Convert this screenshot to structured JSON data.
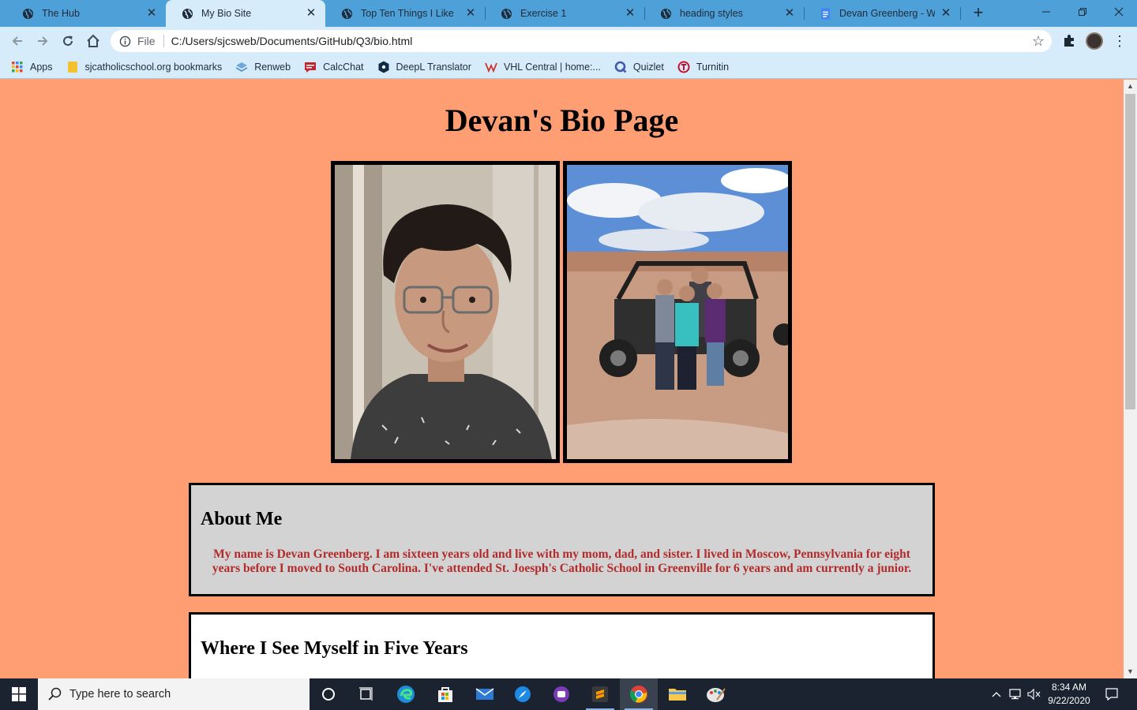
{
  "browser": {
    "tabs": [
      {
        "title": "The Hub",
        "icon": "globe-icon"
      },
      {
        "title": "My Bio Site",
        "icon": "globe-icon",
        "active": true
      },
      {
        "title": "Top Ten Things I Like",
        "icon": "globe-icon"
      },
      {
        "title": "Exercise 1",
        "icon": "globe-icon"
      },
      {
        "title": "heading styles",
        "icon": "globe-icon"
      },
      {
        "title": "Devan Greenberg - Web I",
        "icon": "docs-icon"
      }
    ],
    "address": {
      "scheme_label": "File",
      "url": "C:/Users/sjcsweb/Documents/GitHub/Q3/bio.html"
    },
    "bookmarks": [
      {
        "label": "Apps",
        "icon": "apps-grid-icon"
      },
      {
        "label": "sjcatholicschool.org bookmarks",
        "icon": "folder-icon"
      },
      {
        "label": "Renweb",
        "icon": "renweb-icon"
      },
      {
        "label": "CalcChat",
        "icon": "calcchat-icon"
      },
      {
        "label": "DeepL Translator",
        "icon": "deepl-icon"
      },
      {
        "label": "VHL Central | home:...",
        "icon": "vhl-icon"
      },
      {
        "label": "Quizlet",
        "icon": "quizlet-icon"
      },
      {
        "label": "Turnitin",
        "icon": "turnitin-icon"
      }
    ],
    "colors": {
      "frame": "#4ea0d8",
      "toolbar": "#d7ecfa"
    }
  },
  "page": {
    "title": "Devan's Bio Page",
    "background": "#ff9d73",
    "sections": [
      {
        "heading": "About Me",
        "body": "My name is Devan Greenberg. I am sixteen years old and live with my mom, dad, and sister. I lived in Moscow, Pennsylvania for eight years before I moved to South Carolina. I've attended St. Joesph's Catholic School in Greenville for 6 years and am currently a junior.",
        "background": "#d3d3d3"
      },
      {
        "heading": "Where I See Myself in Five Years",
        "background": "#ffffff"
      }
    ],
    "text_color": "#b32a2a"
  },
  "taskbar": {
    "search_placeholder": "Type here to search",
    "time": "8:34 AM",
    "date": "9/22/2020"
  }
}
